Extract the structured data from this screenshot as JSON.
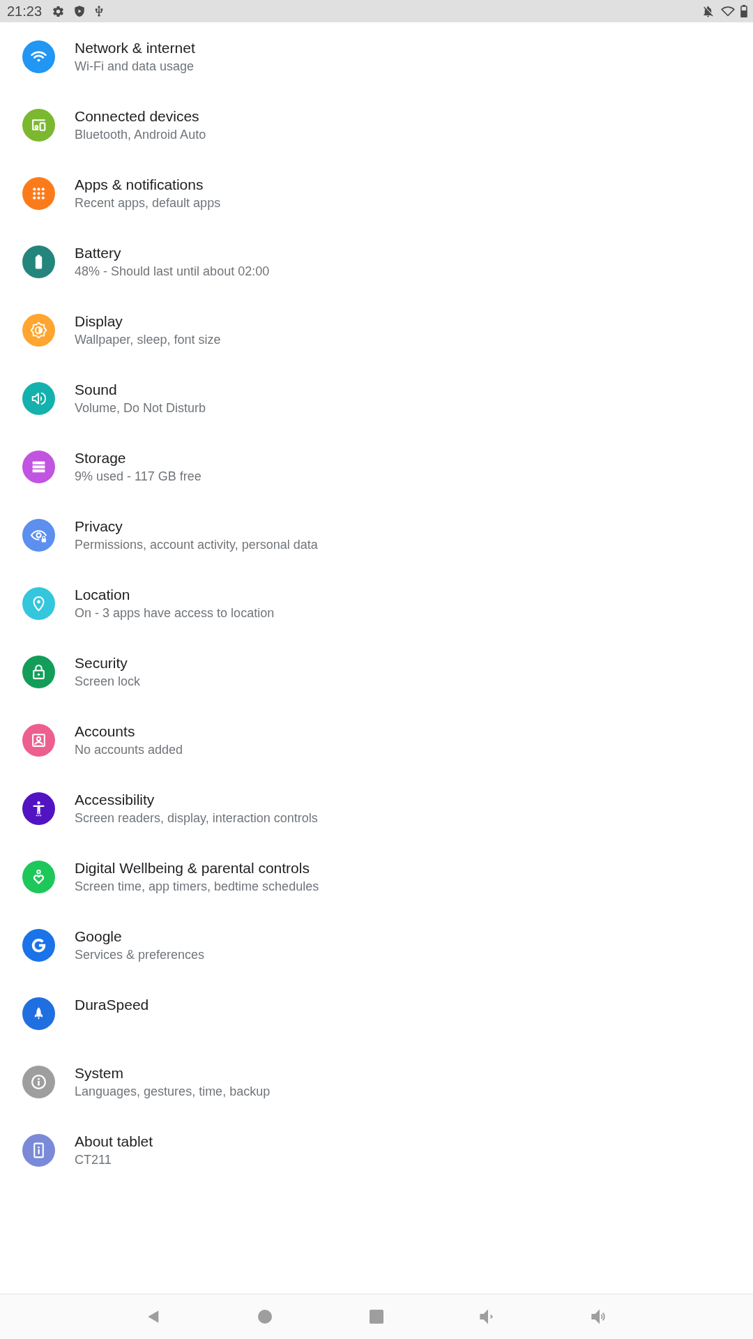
{
  "status_bar": {
    "time": "21:23"
  },
  "settings": [
    {
      "title": "Network & internet",
      "subtitle": "Wi-Fi and data usage",
      "color": "#2196f3"
    },
    {
      "title": "Connected devices",
      "subtitle": "Bluetooth, Android Auto",
      "color": "#7cb82f"
    },
    {
      "title": "Apps & notifications",
      "subtitle": "Recent apps, default apps",
      "color": "#fb7b1b"
    },
    {
      "title": "Battery",
      "subtitle": "48% - Should last until about 02:00",
      "color": "#24857c"
    },
    {
      "title": "Display",
      "subtitle": "Wallpaper, sleep, font size",
      "color": "#ffa530"
    },
    {
      "title": "Sound",
      "subtitle": "Volume, Do Not Disturb",
      "color": "#14b1ad"
    },
    {
      "title": "Storage",
      "subtitle": "9% used - 117 GB free",
      "color": "#c154e0"
    },
    {
      "title": "Privacy",
      "subtitle": "Permissions, account activity, personal data",
      "color": "#5c8fee"
    },
    {
      "title": "Location",
      "subtitle": "On - 3 apps have access to location",
      "color": "#33c6dd"
    },
    {
      "title": "Security",
      "subtitle": "Screen lock",
      "color": "#129d59"
    },
    {
      "title": "Accounts",
      "subtitle": "No accounts added",
      "color": "#ed5f8f"
    },
    {
      "title": "Accessibility",
      "subtitle": "Screen readers, display, interaction controls",
      "color": "#5214c2"
    },
    {
      "title": "Digital Wellbeing & parental controls",
      "subtitle": "Screen time, app timers, bedtime schedules",
      "color": "#1ec759"
    },
    {
      "title": "Google",
      "subtitle": "Services & preferences",
      "color": "#1a73e8"
    },
    {
      "title": "DuraSpeed",
      "color": "#1f6fe0"
    },
    {
      "title": "System",
      "subtitle": "Languages, gestures, time, backup",
      "color": "#9e9e9e"
    },
    {
      "title": "About tablet",
      "subtitle": "CT211",
      "color": "#7a8ad8"
    }
  ]
}
